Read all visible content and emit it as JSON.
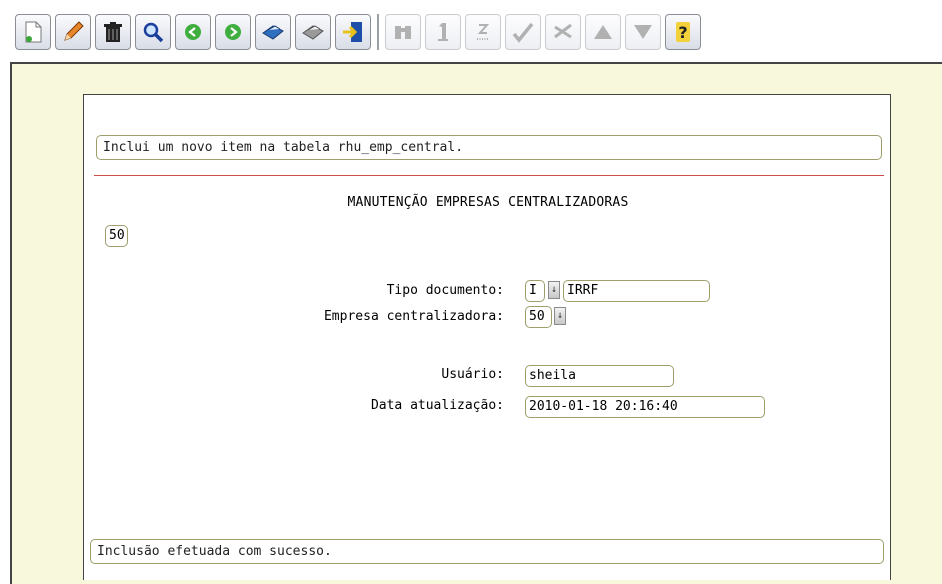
{
  "toolbar": {
    "buttons": [
      {
        "name": "new-icon",
        "tooltip": "incluir"
      },
      {
        "name": "edit-icon",
        "tooltip": "modificar"
      },
      {
        "name": "trash-icon",
        "tooltip": "excluir"
      },
      {
        "name": "search-icon",
        "tooltip": "consultar"
      },
      {
        "name": "previous-icon",
        "tooltip": "anterior"
      },
      {
        "name": "next-icon",
        "tooltip": "proximo"
      },
      {
        "name": "print-icon",
        "tooltip": "listar"
      },
      {
        "name": "printer-icon",
        "tooltip": "imprimir"
      },
      {
        "name": "exit-icon",
        "tooltip": "sair"
      },
      {
        "name": "binoculars-icon",
        "tooltip": "pesquisar"
      },
      {
        "name": "first-icon",
        "tooltip": "primeiro"
      },
      {
        "name": "last-icon",
        "tooltip": "ultimo"
      },
      {
        "name": "confirm-icon",
        "tooltip": "confirmar"
      },
      {
        "name": "cancel-icon",
        "tooltip": "cancelar"
      },
      {
        "name": "up-icon",
        "tooltip": "subir"
      },
      {
        "name": "down-icon",
        "tooltip": "descer"
      },
      {
        "name": "help-icon",
        "tooltip": "ajuda"
      }
    ]
  },
  "help_text": "Inclui um novo item na tabela rhu_emp_central.",
  "form": {
    "title": "MANUTENÇÃO EMPRESAS CENTRALIZADORAS",
    "company_code": "50",
    "tipo_documento": {
      "label": "Tipo documento:",
      "code": "I",
      "description": "IRRF"
    },
    "empresa_centralizadora": {
      "label": "Empresa centralizadora:",
      "value": "50"
    },
    "usuario": {
      "label": "Usuário:",
      "value": "sheila"
    },
    "data_atualizacao": {
      "label": "Data atualização:",
      "value": "2010-01-18 20:16:40"
    }
  },
  "status_message": "Inclusão efetuada com sucesso.",
  "colors": {
    "frame_bg": "#f8f8dc",
    "red_line": "#d24a4a",
    "field_border": "#9e9e6a"
  }
}
